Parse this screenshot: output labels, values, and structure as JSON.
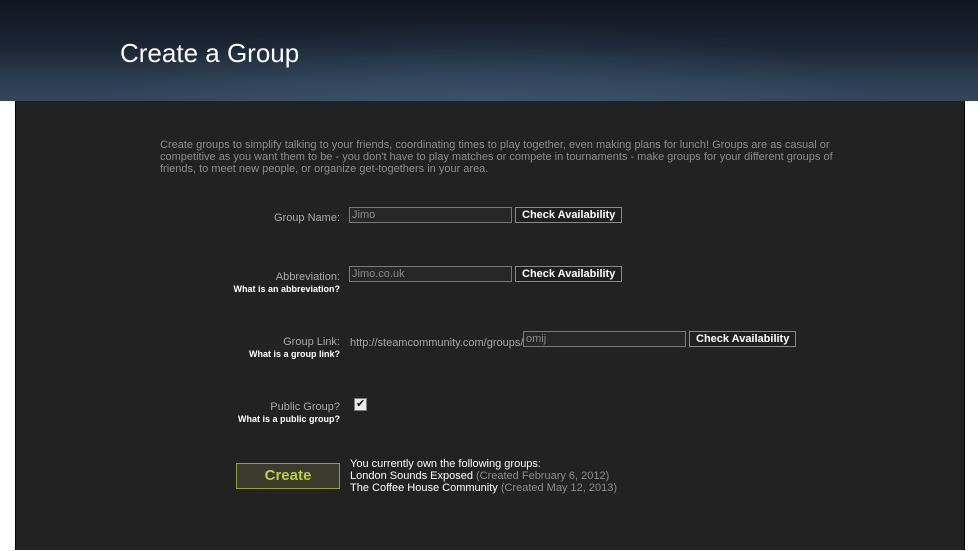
{
  "header": {
    "title": "Create a Group"
  },
  "intro": "Create groups to simplify talking to your friends, coordinating times to play together, even making plans for lunch! Groups are as casual or competitive as you want them to be - you don't have to play matches or compete in tournaments - make groups for your different groups of friends, to meet new people, or organize get-togethers in your area.",
  "form": {
    "group_name": {
      "label": "Group Name:",
      "value": "Jimo",
      "check_label": "Check Availability"
    },
    "abbreviation": {
      "label": "Abbreviation:",
      "help": "What is an abbreviation?",
      "value": "Jimo.co.uk",
      "check_label": "Check Availability"
    },
    "group_link": {
      "label": "Group Link:",
      "help": "What is a group link?",
      "prefix": "http://steamcommunity.com/groups/",
      "value": "omij",
      "check_label": "Check Availability"
    },
    "public_group": {
      "label": "Public Group?",
      "help": "What is a public group?",
      "checked": true,
      "check_glyph": "✔"
    },
    "create_label": "Create"
  },
  "owned": {
    "heading": "You currently own the following groups:",
    "groups": [
      {
        "name": "London Sounds Exposed",
        "created": "(Created February 6, 2012)"
      },
      {
        "name": "The Coffee House Community",
        "created": "(Created May 12, 2013)"
      }
    ]
  },
  "colors": {
    "accent_green": "#b6d13d",
    "panel_bg": "#222222"
  }
}
